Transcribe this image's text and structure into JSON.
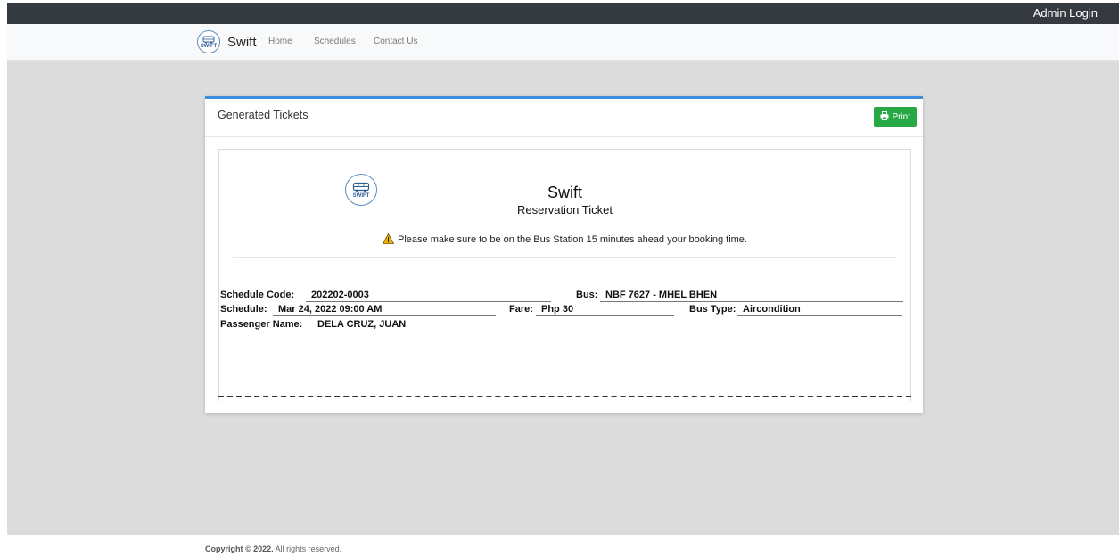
{
  "header": {
    "admin_login": "Admin Login"
  },
  "brand": {
    "name": "Swift",
    "logo_text": "SWIFT"
  },
  "nav": {
    "home": "Home",
    "schedules": "Schedules",
    "contact": "Contact Us"
  },
  "card": {
    "title": "Generated Tickets",
    "print_label": "Print"
  },
  "ticket": {
    "title": "Swift",
    "subtitle": "Reservation Ticket",
    "logo_text": "SWIFT",
    "notice": "Please make sure to be on the Bus Station 15 minutes ahead your booking time.",
    "schedule_code_label": "Schedule Code:",
    "schedule_code": "202202-0003",
    "bus_label": "Bus:",
    "bus": "NBF 7627 - MHEL BHEN",
    "schedule_label": "Schedule:",
    "schedule": "Mar 24, 2022 09:00 AM",
    "fare_label": "Fare:",
    "fare": "Php 30",
    "bus_type_label": "Bus Type:",
    "bus_type": "Aircondition",
    "passenger_label": "Passenger Name:",
    "passenger": "DELA CRUZ, JUAN"
  },
  "footer": {
    "copyright_bold": "Copyright © 2022.",
    "rights": " All rights reserved."
  },
  "colors": {
    "topbar": "#343a40",
    "accent": "#3c8dde",
    "print": "#28a745",
    "warning": "#f0b400"
  },
  "icons": {
    "logo": "bus-logo-icon",
    "print": "printer-icon",
    "warning": "warning-icon"
  }
}
